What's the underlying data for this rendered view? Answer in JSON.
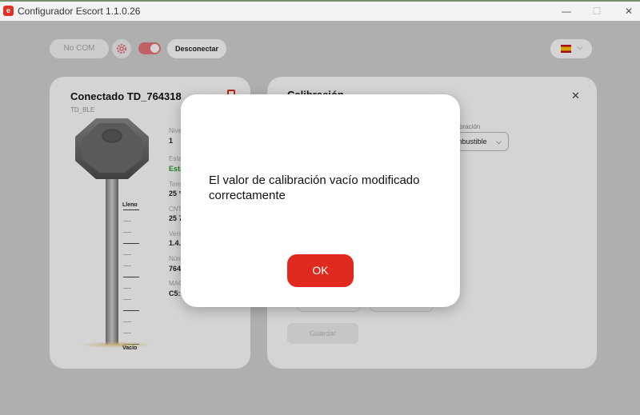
{
  "window": {
    "title": "Configurador Escort 1.1.0.26",
    "logo_text": "e",
    "controls": {
      "minimize": "—",
      "maximize": "☐",
      "close": "✕"
    }
  },
  "toolbar": {
    "port_label": "No COM",
    "settings_icon": "gear-icon",
    "toggle_on": true,
    "disconnect_label": "Desconectar",
    "language_flag": "es",
    "language_chevron": "⌵"
  },
  "device_card": {
    "title": "Conectado  TD_764318",
    "subtitle": "TD_BLE",
    "gauge": {
      "top_label": "Lleno",
      "bottom_label": "Vacío"
    },
    "fields": [
      {
        "label": "Nive",
        "value": "1",
        "green": false
      },
      {
        "label": "Esta",
        "value": "Esta",
        "green": true
      },
      {
        "label": "Tem",
        "value": "25 °",
        "green": false
      },
      {
        "label": "CNT",
        "value": "25 7",
        "green": false
      },
      {
        "label": "Vers",
        "value": "1.4.",
        "green": false
      },
      {
        "label": "Núm",
        "value": "764",
        "green": false
      },
      {
        "label": "MAC",
        "value": "C5:",
        "green": false
      }
    ]
  },
  "calibration_card": {
    "title": "Calibración",
    "close": "✕",
    "select_label": "alibración",
    "select_value": "ombustible",
    "select_chevron": "⌵",
    "save_label": "Guardar"
  },
  "dialog": {
    "message": "El valor de calibración vacío modificado correctamente",
    "ok_label": "OK"
  },
  "colors": {
    "accent": "#e02a1f",
    "status_green": "#2aa02a",
    "background": "#d3d3d3"
  }
}
